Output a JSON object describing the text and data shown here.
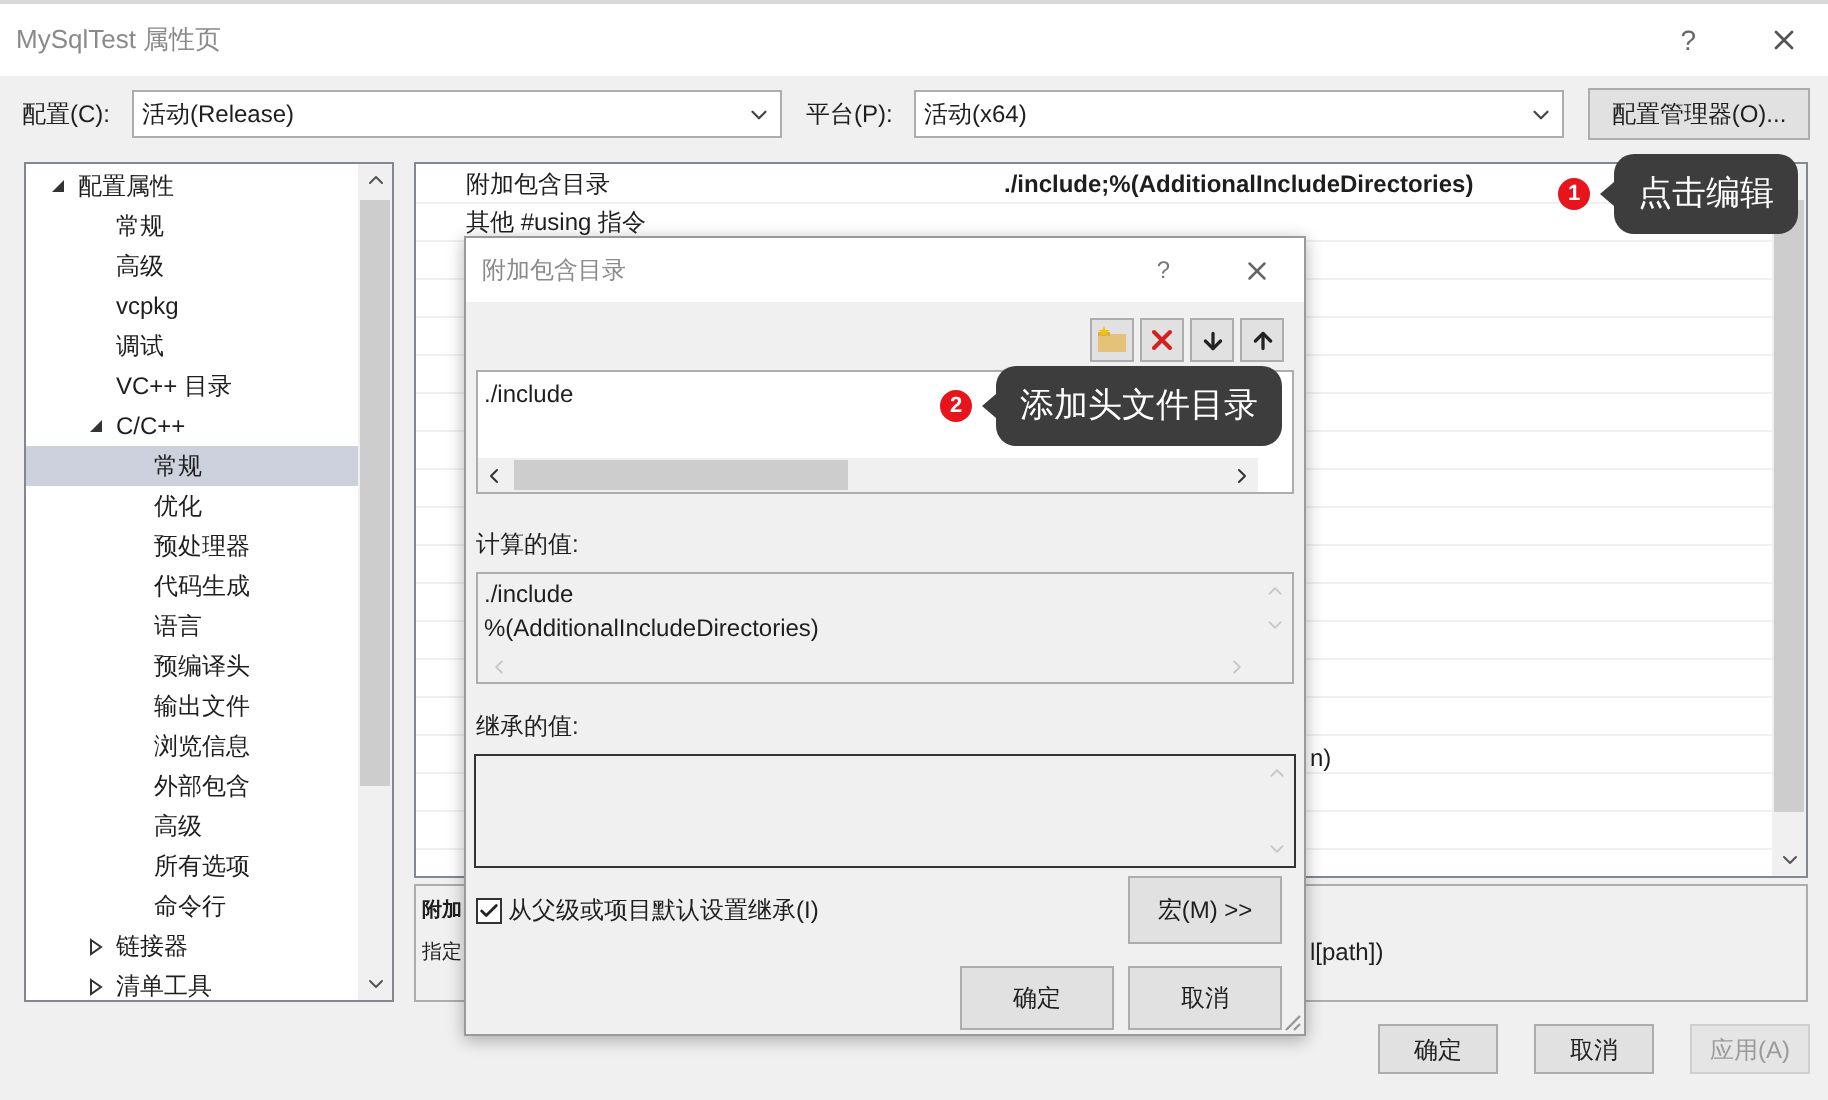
{
  "window": {
    "title": "MySqlTest 属性页",
    "help": "?"
  },
  "config_bar": {
    "config_label": "配置(C):",
    "config_value": "活动(Release)",
    "platform_label": "平台(P):",
    "platform_value": "活动(x64)",
    "manager_button": "配置管理器(O)..."
  },
  "tree": [
    {
      "label": "配置属性",
      "selected": false,
      "expanded": true,
      "children": [
        {
          "label": "常规",
          "selected": false
        },
        {
          "label": "高级",
          "selected": false
        },
        {
          "label": "vcpkg",
          "selected": false
        },
        {
          "label": "调试",
          "selected": false
        },
        {
          "label": "VC++ 目录",
          "selected": false
        },
        {
          "label": "C/C++",
          "selected": false,
          "expanded": true,
          "children": [
            {
              "label": "常规",
              "selected": true
            },
            {
              "label": "优化",
              "selected": false
            },
            {
              "label": "预处理器",
              "selected": false
            },
            {
              "label": "代码生成",
              "selected": false
            },
            {
              "label": "语言",
              "selected": false
            },
            {
              "label": "预编译头",
              "selected": false
            },
            {
              "label": "输出文件",
              "selected": false
            },
            {
              "label": "浏览信息",
              "selected": false
            },
            {
              "label": "外部包含",
              "selected": false
            },
            {
              "label": "高级",
              "selected": false
            },
            {
              "label": "所有选项",
              "selected": false
            },
            {
              "label": "命令行",
              "selected": false
            }
          ]
        },
        {
          "label": "链接器",
          "selected": false,
          "expanded": false
        },
        {
          "label": "清单工具",
          "selected": false,
          "expanded": false
        }
      ]
    }
  ],
  "property_grid": {
    "rows": [
      {
        "name": "附加包含目录",
        "value": "./include;%(AdditionalIncludeDirectories)"
      },
      {
        "name": "其他 #using 指令"
      }
    ],
    "partial_text": "n)"
  },
  "description": {
    "title": "附加",
    "text_start": "指定",
    "text_end": "l[path])"
  },
  "buttons": [
    {
      "label": "确定",
      "disabled": false
    },
    {
      "label": "取消",
      "disabled": false
    },
    {
      "label": "应用(A)",
      "disabled": true
    }
  ],
  "dialog": {
    "title": "附加包含目录",
    "help": "?",
    "entries": [
      "./include"
    ],
    "computed_label": "计算的值:",
    "computed_values": [
      "./include",
      "%(AdditionalIncludeDirectories)"
    ],
    "inherited_label": "继承的值:",
    "inherit_checkbox": {
      "label": "从父级或项目默认设置继承(I)",
      "checked": true
    },
    "macro_button": "宏(M) >>",
    "buttons": [
      "确定",
      "取消"
    ]
  },
  "annotations": [
    {
      "number": "1",
      "text": "点击编辑"
    },
    {
      "number": "2",
      "text": "添加头文件目录"
    }
  ]
}
